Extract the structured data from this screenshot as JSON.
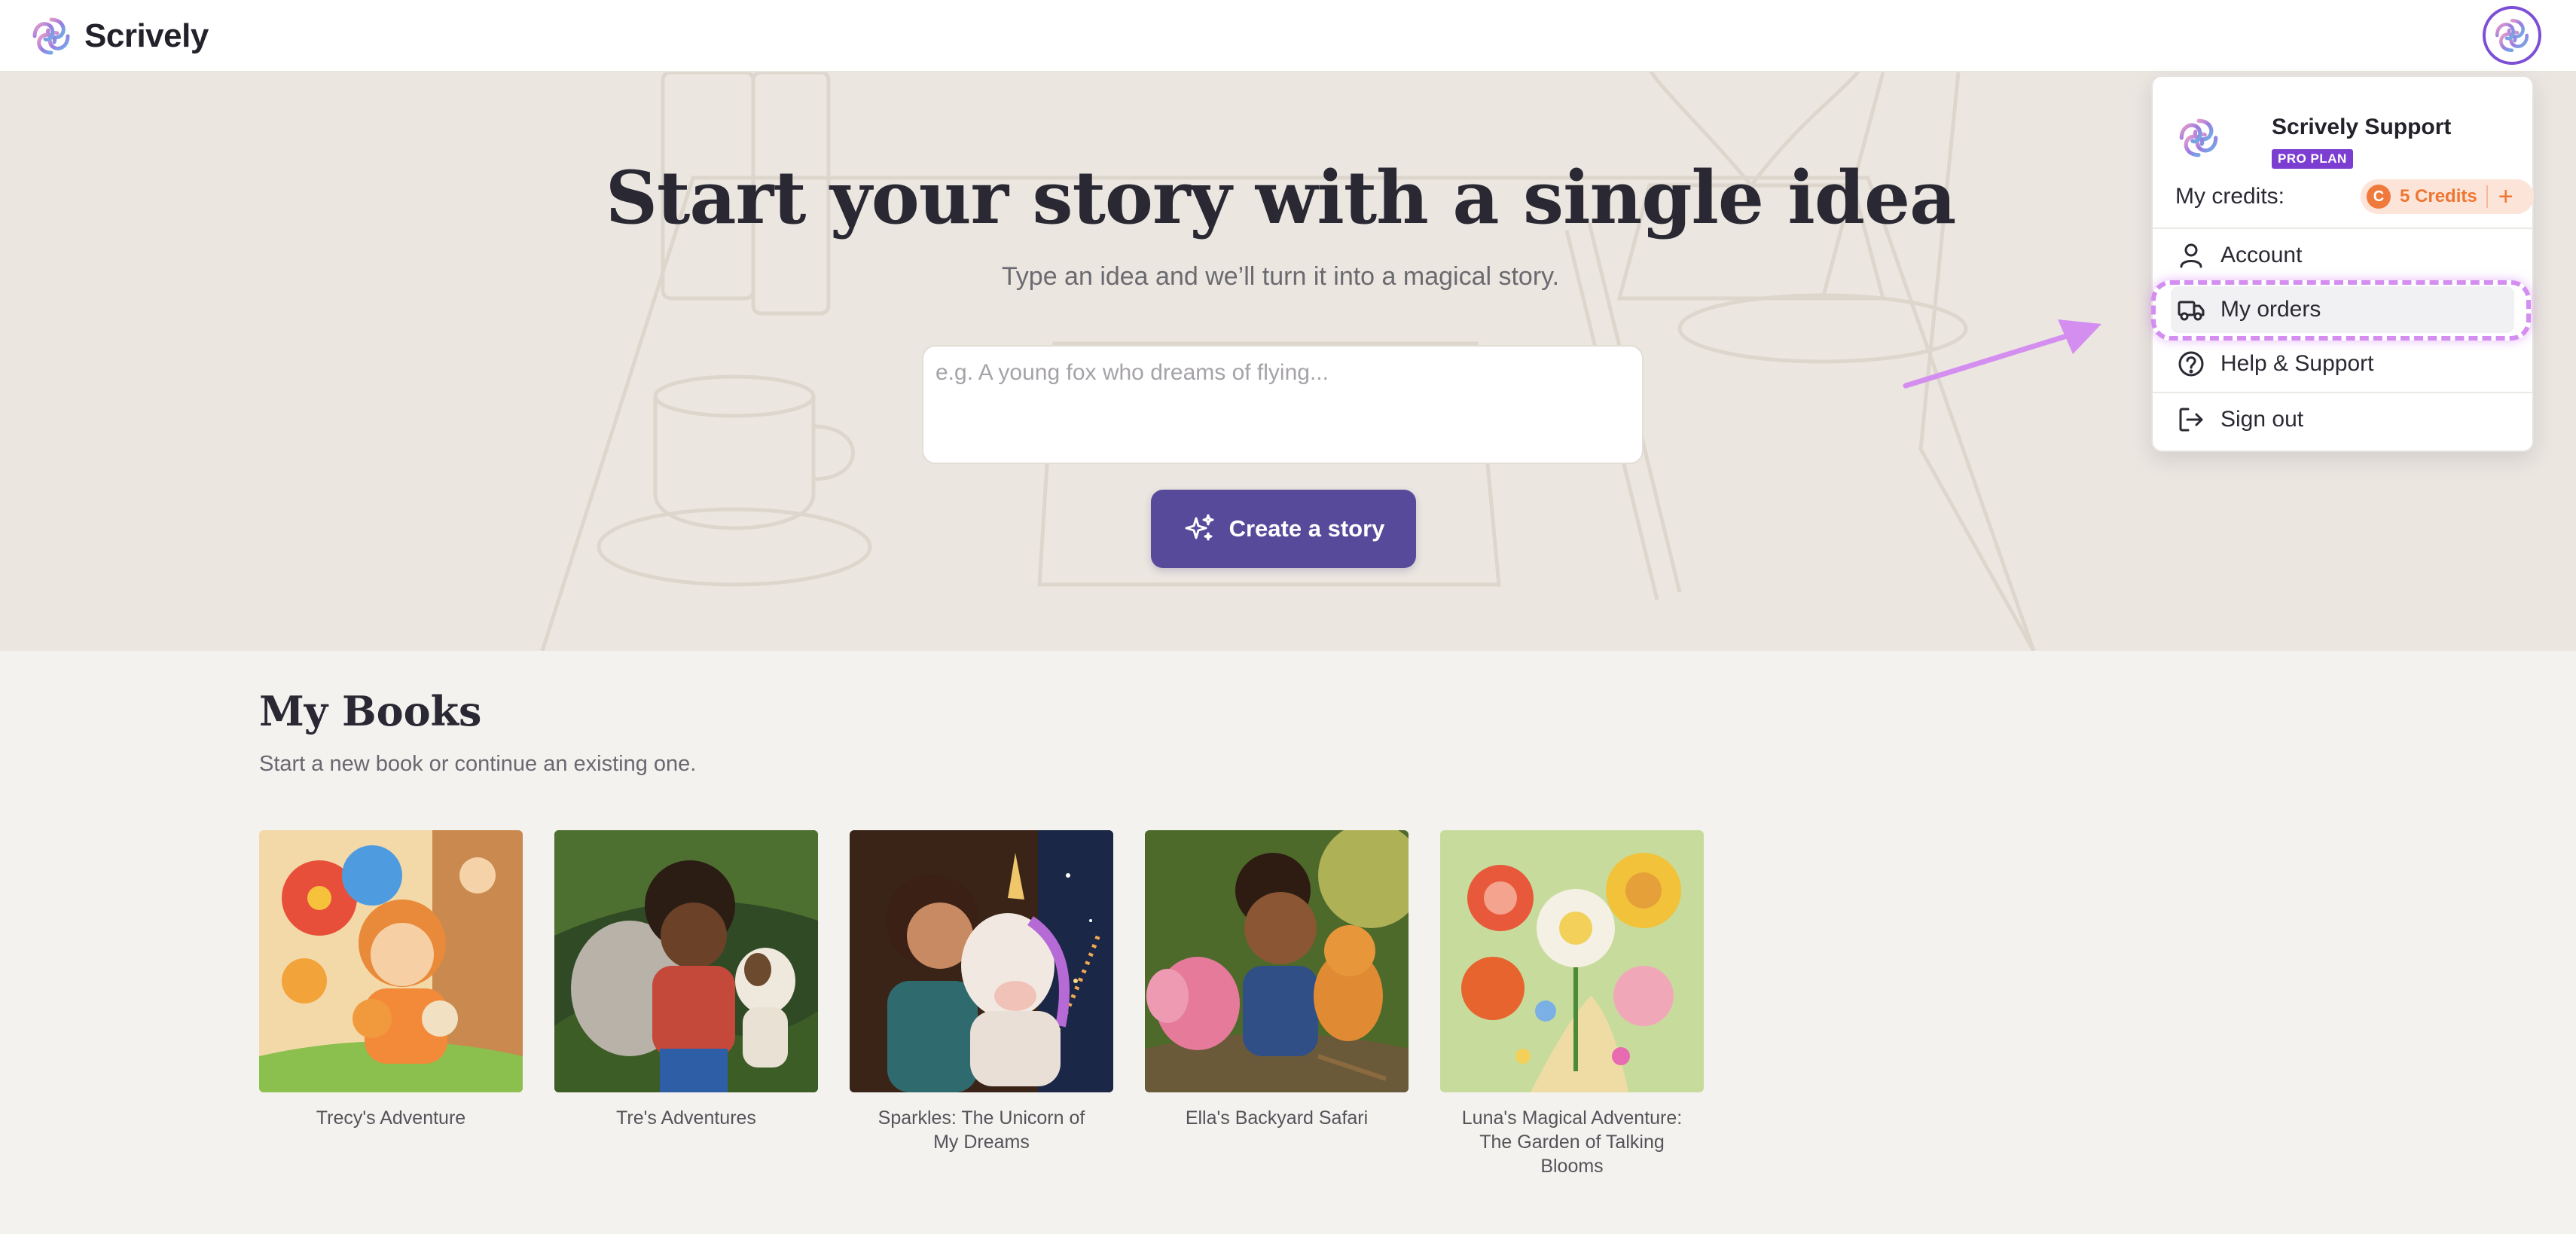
{
  "app": {
    "name": "Scrively",
    "logo_icon": "scrively-swirl-logo"
  },
  "colors": {
    "accent": "#574a9a",
    "brand_purple": "#7c3ed0",
    "credits_orange": "#ee7633",
    "highlight": "#d48ef0"
  },
  "hero": {
    "title": "Start your story with a single idea",
    "subtitle": "Type an idea and we’ll turn it into a magical story.",
    "idea_placeholder": "e.g. A young fox who dreams of flying...",
    "idea_value": "",
    "create_button": "Create a story"
  },
  "books": {
    "title": "My Books",
    "subtitle": "Start a new book or continue an existing one.",
    "items": [
      {
        "title": "Trecy's Adventure"
      },
      {
        "title": "Tre's Adventures"
      },
      {
        "title": "Sparkles: The Unicorn of My Dreams"
      },
      {
        "title": "Ella's Backyard Safari"
      },
      {
        "title": "Luna's Magical Adventure: The Garden of Talking Blooms"
      }
    ]
  },
  "user_menu": {
    "user_name": "Scrively Support",
    "plan_badge": "PRO PLAN",
    "credits_label": "My credits:",
    "credits_value": "5 Credits",
    "coin_glyph": "C",
    "plus_glyph": "+",
    "items": [
      {
        "label": "Account",
        "icon": "user-icon"
      },
      {
        "label": "My orders",
        "icon": "truck-icon",
        "highlighted": true
      },
      {
        "label": "Help & Support",
        "icon": "help-circle-icon"
      },
      {
        "label": "Sign out",
        "icon": "sign-out-icon"
      }
    ]
  }
}
